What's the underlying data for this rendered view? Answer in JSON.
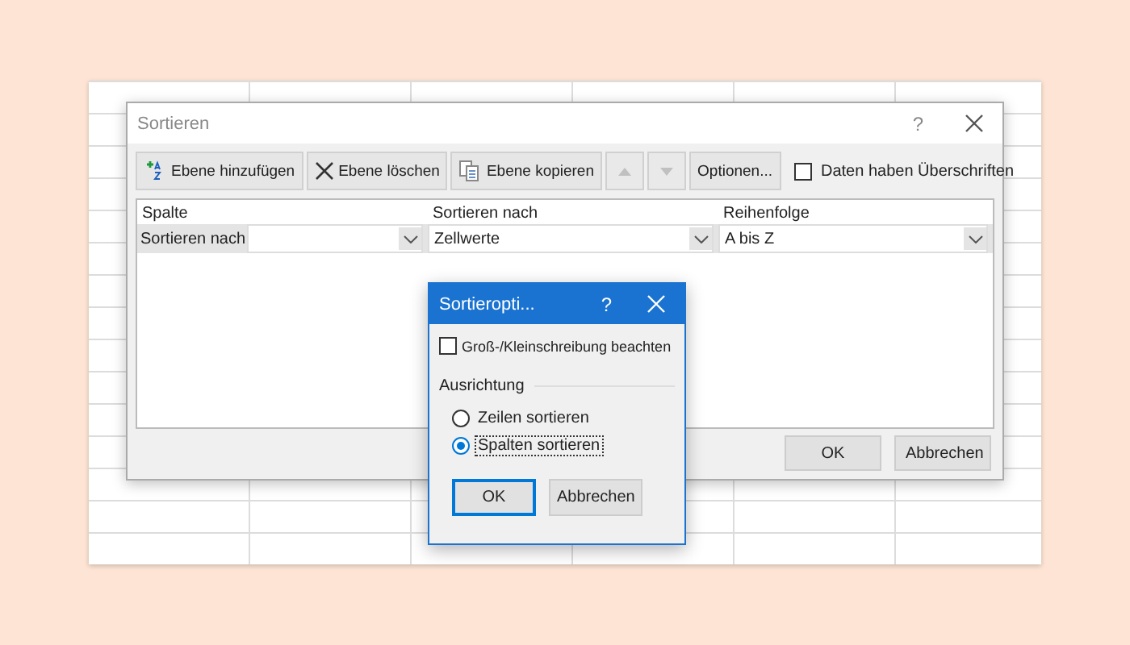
{
  "window": {
    "title": "Sortieren",
    "help": "?"
  },
  "toolbar": {
    "buttons": [
      {
        "kind": "add",
        "label": "Ebene hinzufügen"
      },
      {
        "kind": "delete",
        "label": "Ebene löschen"
      },
      {
        "kind": "copy",
        "label": "Ebene kopieren"
      }
    ],
    "move": [
      {
        "kind": "up",
        "disabled": true
      },
      {
        "kind": "down",
        "disabled": true
      }
    ],
    "options": "Optionen...",
    "headers_checkbox": {
      "label": "Daten haben Überschriften",
      "checked": false
    }
  },
  "columns": [
    "Spalte",
    "Sortieren nach",
    "Reihenfolge"
  ],
  "rows": [
    {
      "label": "Sortieren nach",
      "sort_on": "Zellwerte",
      "order": "A bis Z"
    }
  ],
  "footer_buttons": [
    "OK",
    "Abbrechen"
  ],
  "options_dialog": {
    "title": "Sortieropti...",
    "help": "?",
    "case_checkbox": {
      "label": "Groß-/Kleinschreibung beachten",
      "checked": false
    },
    "group": "Ausrichtung",
    "radios": [
      {
        "label": "Zeilen sortieren",
        "selected": false,
        "focused": false
      },
      {
        "label": "Spalten sortieren",
        "selected": true,
        "focused": true
      }
    ],
    "buttons": [
      {
        "label": "OK",
        "default": true
      },
      {
        "label": "Abbrechen",
        "default": false
      }
    ]
  }
}
